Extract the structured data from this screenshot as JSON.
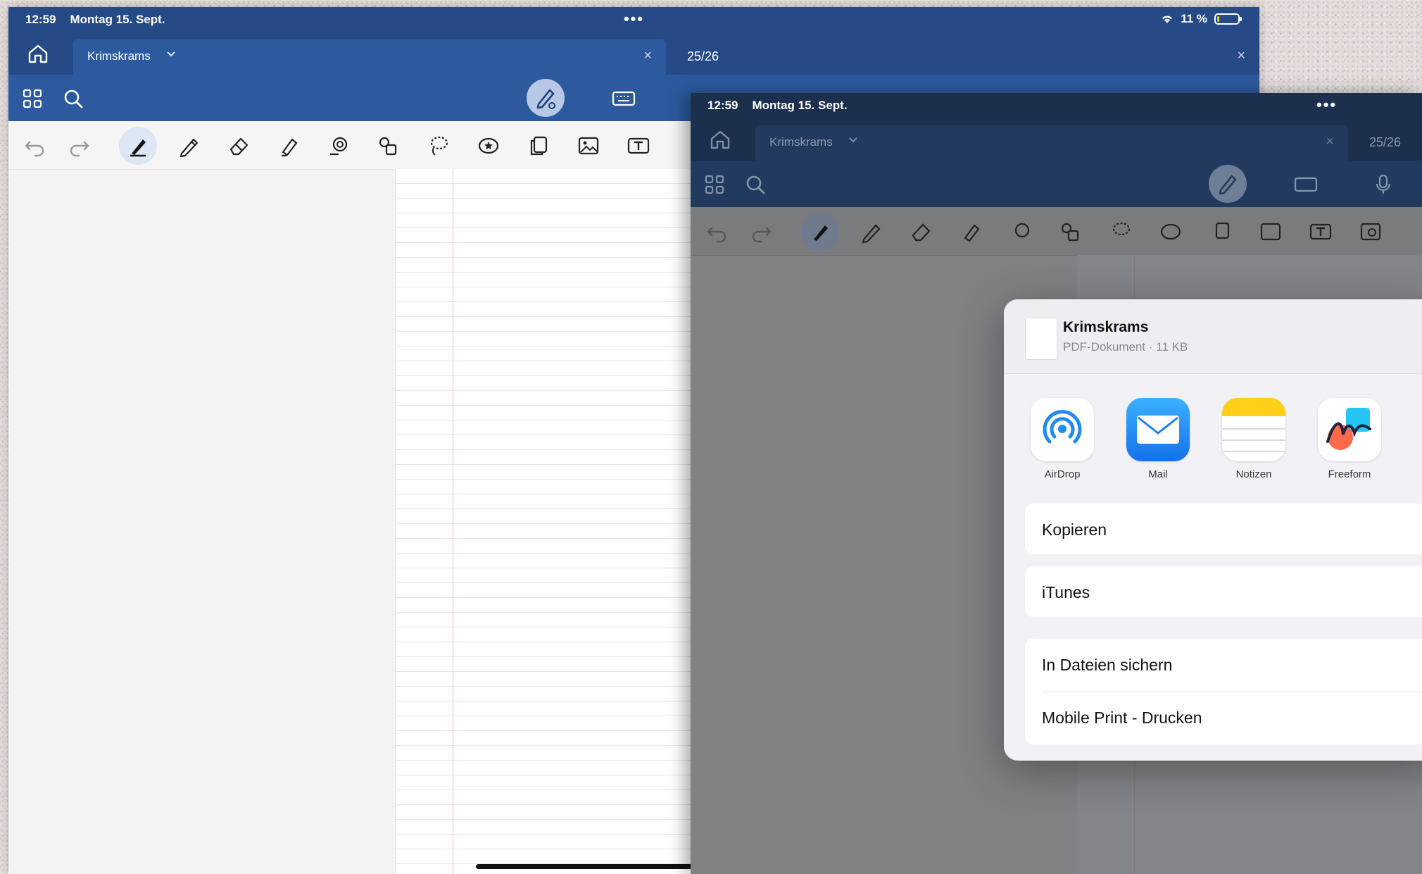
{
  "left": {
    "status": {
      "time": "12:59",
      "date": "Montag 15. Sept.",
      "battery": "11 %",
      "battery_level": 0.11
    },
    "tab": {
      "title": "Krimskrams",
      "other_tab": "25/26"
    }
  },
  "right": {
    "status": {
      "time": "12:59",
      "date": "Montag 15. Sept."
    },
    "tab": {
      "title": "Krimskrams",
      "other_tab": "25/26"
    }
  },
  "share_sheet": {
    "doc_title": "Krimskrams",
    "doc_subtitle": "PDF-Dokument · 11 KB",
    "apps": [
      {
        "name": "AirDrop",
        "icon": "airdrop-icon"
      },
      {
        "name": "Mail",
        "icon": "mail-icon"
      },
      {
        "name": "Notizen",
        "icon": "notes-icon"
      },
      {
        "name": "Freeform",
        "icon": "freeform-icon"
      }
    ],
    "actions": [
      "Kopieren",
      "iTunes",
      "In Dateien sichern",
      "Mobile Print - Drucken"
    ]
  },
  "colors": {
    "header_blue": "#254a86",
    "toolbar_blue": "#2d5a9e",
    "margin_red": "#f0b9b9",
    "mail_blue": "#1e88f5",
    "notes_yellow": "#ffcf1a"
  }
}
